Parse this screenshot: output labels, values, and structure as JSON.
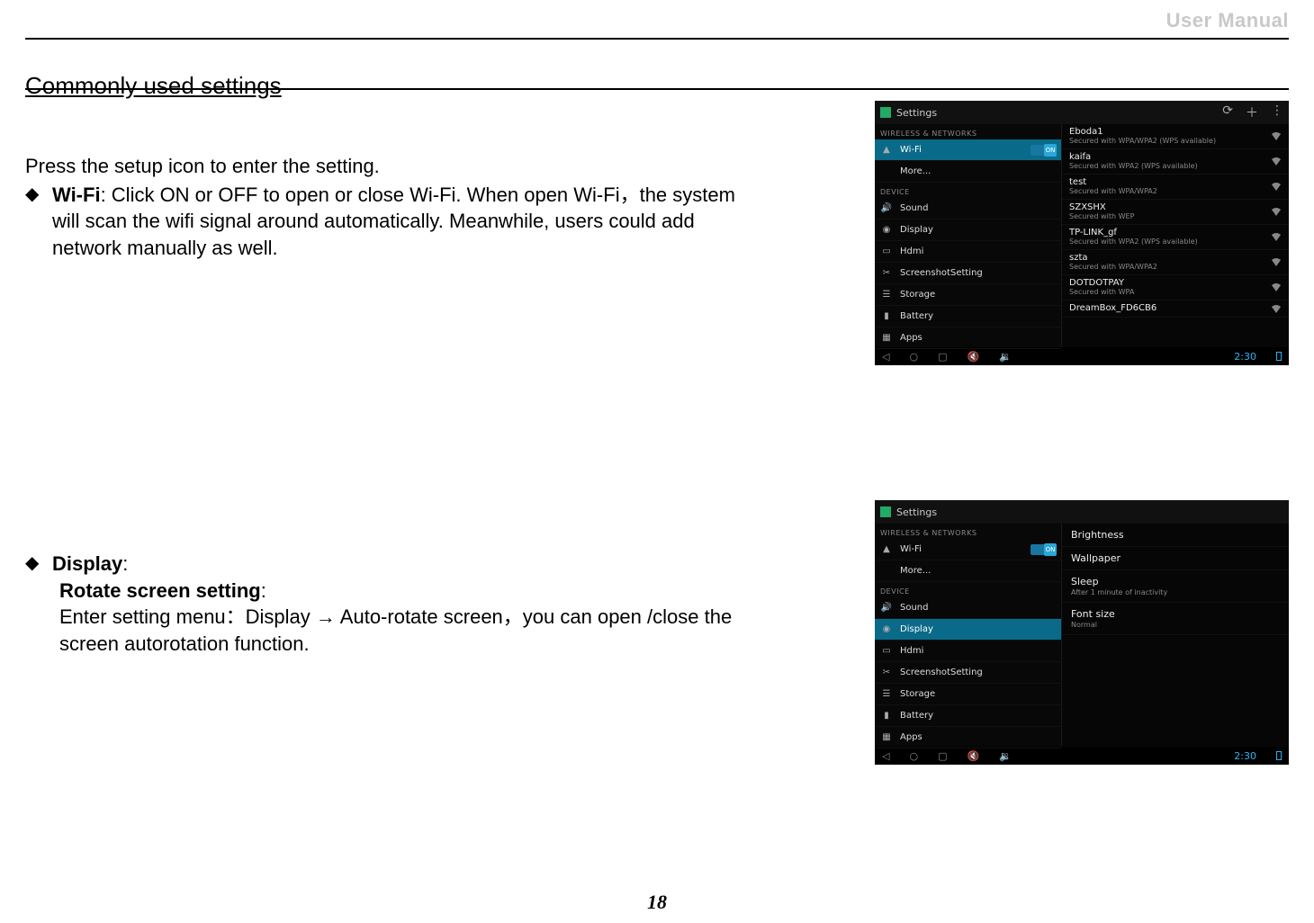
{
  "page": {
    "header_label": "User Manual",
    "section_title": "Commonly used settings",
    "page_number": "18"
  },
  "text": {
    "intro": "Press the setup icon to enter the setting.",
    "wifi_label": "Wi-Fi",
    "wifi_body": ": Click ON or OFF to open or close Wi-Fi. When open Wi-Fi，the system will scan the wifi signal around automatically. Meanwhile, users could add network manually as well.",
    "display_label": "Display",
    "display_colon": ":",
    "rotate_label": "Rotate screen setting",
    "rotate_colon": ":",
    "rotate_body_1": "Enter setting menu：Display ",
    "rotate_arrow": "→",
    "rotate_body_2": " Auto-rotate screen，you can open /close the screen autorotation function."
  },
  "screenshot_common": {
    "title": "Settings",
    "cat_wireless": "WIRELESS & NETWORKS",
    "cat_device": "DEVICE",
    "clock": "2:30",
    "toggle_on_text": "ON",
    "left": {
      "wifi": "Wi-Fi",
      "more": "More...",
      "sound": "Sound",
      "display": "Display",
      "hdmi": "Hdmi",
      "screenshot": "ScreenshotSetting",
      "storage": "Storage",
      "battery": "Battery",
      "apps": "Apps"
    }
  },
  "screenshot1": {
    "networks": [
      {
        "name": "Eboda1",
        "sub": "Secured with WPA/WPA2 (WPS available)"
      },
      {
        "name": "kaifa",
        "sub": "Secured with WPA2 (WPS available)"
      },
      {
        "name": "test",
        "sub": "Secured with WPA/WPA2"
      },
      {
        "name": "SZXSHX",
        "sub": "Secured with WEP"
      },
      {
        "name": "TP-LINK_gf",
        "sub": "Secured with WPA2 (WPS available)"
      },
      {
        "name": "szta",
        "sub": "Secured with WPA/WPA2"
      },
      {
        "name": "DOTDOTPAY",
        "sub": "Secured with WPA"
      },
      {
        "name": "DreamBox_FD6CB6",
        "sub": ""
      }
    ]
  },
  "screenshot2": {
    "options": [
      {
        "name": "Brightness",
        "sub": ""
      },
      {
        "name": "Wallpaper",
        "sub": ""
      },
      {
        "name": "Sleep",
        "sub": "After 1 minute of inactivity"
      },
      {
        "name": "Font size",
        "sub": "Normal"
      }
    ]
  }
}
